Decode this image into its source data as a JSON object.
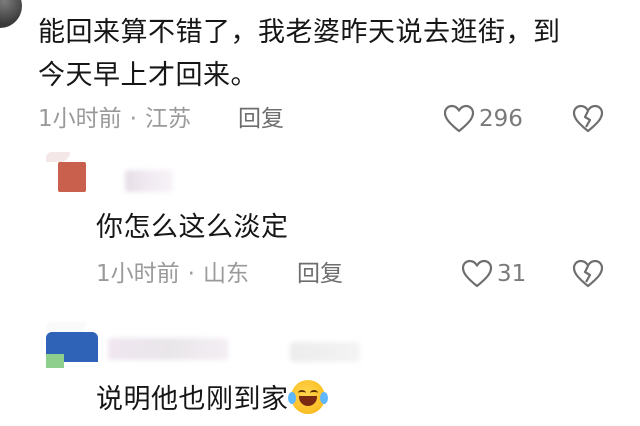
{
  "comments": [
    {
      "text_line1": "能回来算不错了，我老婆昨天说去逛街，到",
      "text_line2": "今天早上才回来。",
      "time": "1小时前",
      "dot": "·",
      "location": "江苏",
      "reply_label": "回复",
      "likes": "296"
    },
    {
      "text": "你怎么这么淡定",
      "time": "1小时前",
      "dot": "·",
      "location": "山东",
      "reply_label": "回复",
      "likes": "31"
    },
    {
      "text": "说明他也刚到家",
      "emoji": "face-with-tears-of-joy"
    }
  ],
  "icons": {
    "like": "heart-outline-icon",
    "dislike": "broken-heart-icon"
  },
  "colors": {
    "text": "#161616",
    "meta": "#9a9a9a",
    "icon": "#6e6e6e"
  }
}
